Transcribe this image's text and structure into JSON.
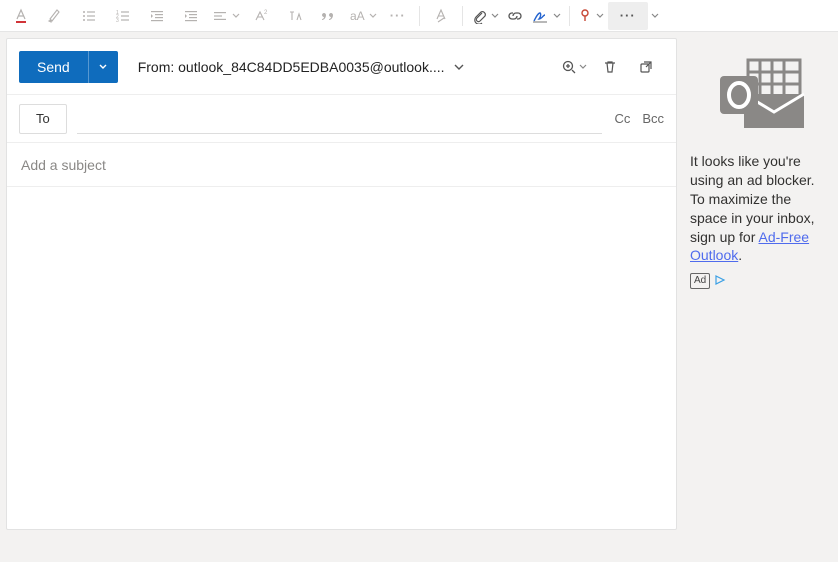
{
  "toolbar": {
    "font_color_icon": "font-color-icon",
    "highlight_icon": "highlight-icon",
    "bullets_icon": "bullets-icon",
    "numbering_icon": "numbering-icon",
    "outdent_icon": "outdent-icon",
    "indent_icon": "indent-icon",
    "align_icon": "align-icon",
    "superscript_icon": "superscript-icon",
    "case_icon": "change-case-icon",
    "quote_icon": "quote-icon",
    "aa_icon": "font-size-icon",
    "more_format_icon": "more-formatting-icon",
    "clear_format_icon": "clear-formatting-icon",
    "attach_icon": "attach-icon",
    "link_icon": "link-icon",
    "signature_icon": "signature-icon",
    "flag_icon": "flag-icon",
    "more_actions_icon": "more-actions-icon"
  },
  "compose": {
    "send_label": "Send",
    "from_label": "From: outlook_84C84DD5EDBA0035@outlook....",
    "zoom_icon": "zoom-icon",
    "delete_icon": "delete-icon",
    "popout_icon": "open-new-window-icon",
    "to_label": "To",
    "cc_label": "Cc",
    "bcc_label": "Bcc",
    "subject_placeholder": "Add a subject"
  },
  "side": {
    "text_part1": "It looks like you're using an ad blocker. To maximize the space in your inbox, sign up for ",
    "link_text": "Ad-Free Outlook",
    "text_part2": ".",
    "ad_badge": "Ad"
  }
}
